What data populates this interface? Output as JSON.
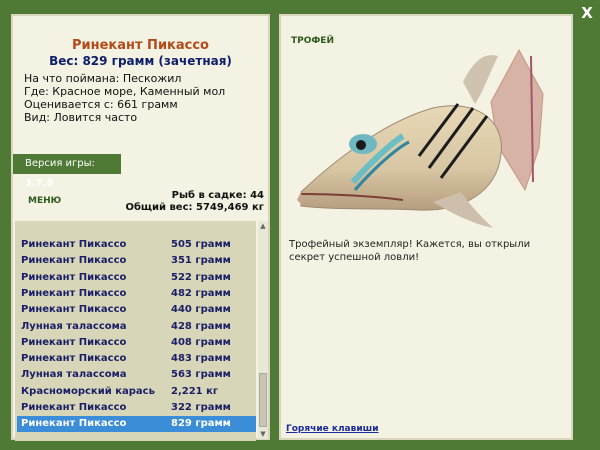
{
  "close_label": "X",
  "fish": {
    "name": "Ринекант Пикассо",
    "weight": "Вес: 829 грамм (зачетная)",
    "caught_on": "На что поймана: Пескожил",
    "location": "Где: Красное море, Каменный мол",
    "valued_from": "Оценивается с: 661 грамм",
    "frequency": "Вид: Ловится часто"
  },
  "version": {
    "label": "Версия игры:",
    "value": "3.7.6"
  },
  "menu_label": "МЕНЮ",
  "stats": {
    "count": "Рыб в садке: 44",
    "total": "Общий вес: 5749,469 кг"
  },
  "catch_list": [
    {
      "name": "Ринекант Пикассо",
      "weight": "505 грамм"
    },
    {
      "name": "Ринекант Пикассо",
      "weight": "351 грамм"
    },
    {
      "name": "Ринекант Пикассо",
      "weight": "522 грамм"
    },
    {
      "name": "Ринекант Пикассо",
      "weight": "482 грамм"
    },
    {
      "name": "Ринекант Пикассо",
      "weight": "440 грамм"
    },
    {
      "name": "Лунная талассома",
      "weight": "428 грамм"
    },
    {
      "name": "Ринекант Пикассо",
      "weight": "408 грамм"
    },
    {
      "name": "Ринекант Пикассо",
      "weight": "483 грамм"
    },
    {
      "name": "Лунная талассома",
      "weight": "563 грамм"
    },
    {
      "name": "Красноморский карась",
      "weight": "2,221 кг"
    },
    {
      "name": "Ринекант Пикассо",
      "weight": "322 грамм"
    },
    {
      "name": "Ринекант Пикассо",
      "weight": "829 грамм"
    }
  ],
  "trophy_label": "ТРОФЕЙ",
  "trophy_text": "Трофейный экземпляр! Кажется, вы открыли секрет успешной ловли!",
  "hotkeys_label": "Горячие клавиши"
}
